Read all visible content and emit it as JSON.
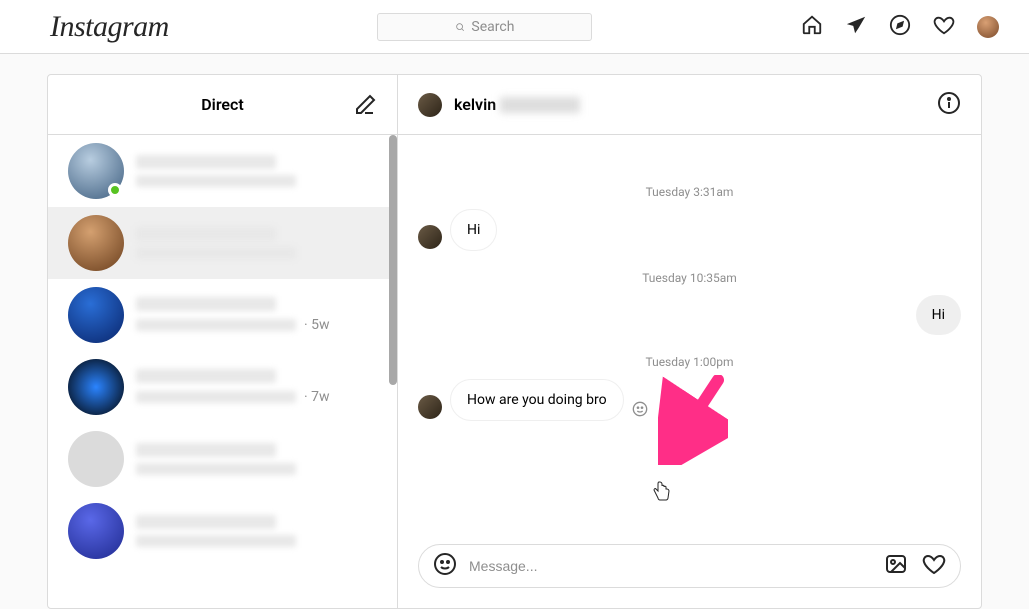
{
  "topbar": {
    "logo": "Instagram",
    "search_placeholder": "Search"
  },
  "sidebar": {
    "title": "Direct",
    "threads": [
      {
        "online": true,
        "time": ""
      },
      {
        "online": false,
        "time": ""
      },
      {
        "online": false,
        "time": "5w"
      },
      {
        "online": false,
        "time": "7w"
      },
      {
        "online": false,
        "time": ""
      },
      {
        "online": false,
        "time": ""
      }
    ]
  },
  "conversation": {
    "username": "kelvin",
    "timeline": [
      {
        "type": "timestamp",
        "text": "Tuesday 3:31am"
      },
      {
        "type": "incoming",
        "text": "Hi"
      },
      {
        "type": "timestamp",
        "text": "Tuesday 10:35am"
      },
      {
        "type": "outgoing",
        "text": "Hi"
      },
      {
        "type": "timestamp",
        "text": "Tuesday 1:00pm"
      },
      {
        "type": "incoming",
        "text": "How are you doing bro"
      }
    ],
    "composer_placeholder": "Message..."
  }
}
